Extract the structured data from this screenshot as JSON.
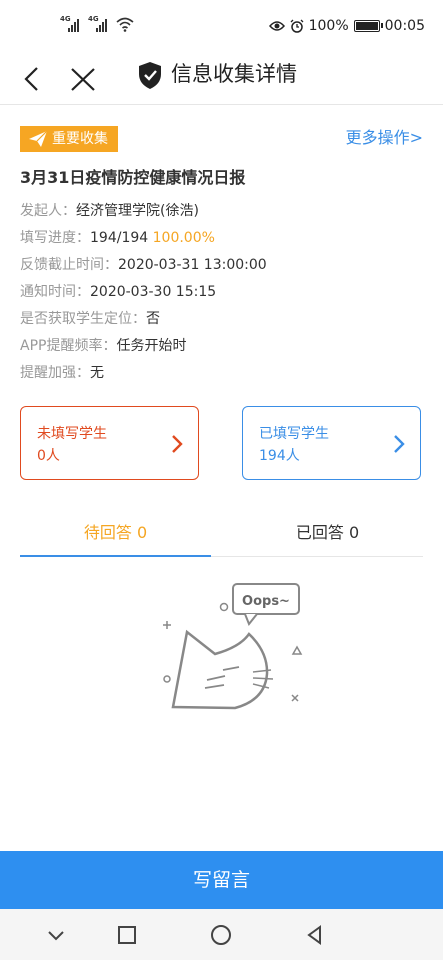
{
  "status_bar": {
    "signal1_tag": "4G",
    "signal2_tag": "4G",
    "battery": "100%",
    "time": "00:05"
  },
  "header": {
    "title": "信息收集详情"
  },
  "notice": {
    "tag": "重要收集",
    "more_actions": "更多操作>",
    "title": "3月31日疫情防控健康情况日报",
    "fields": [
      {
        "label": "发起人：",
        "value": "经济管理学院(徐浩)"
      },
      {
        "label": "填写进度：",
        "value": "194/194",
        "extra": "100.00%"
      },
      {
        "label": "反馈截止时间：",
        "value": "2020-03-31 13:00:00"
      },
      {
        "label": "通知时间：",
        "value": "2020-03-30 15:15"
      },
      {
        "label": "是否获取学生定位：",
        "value": "否"
      },
      {
        "label": "APP提醒频率：",
        "value": "任务开始时"
      },
      {
        "label": "提醒加强：",
        "value": "无"
      }
    ]
  },
  "cards": {
    "unfilled": {
      "title": "未填写学生",
      "count": "0人"
    },
    "filled": {
      "title": "已填写学生",
      "count": "194人"
    }
  },
  "tabs": [
    {
      "label": "待回答 0",
      "active": true
    },
    {
      "label": "已回答 0",
      "active": false
    }
  ],
  "empty_state": {
    "bubble": "Oops~"
  },
  "bottom_button": {
    "label": "写留言"
  },
  "colors": {
    "accent_blue": "#3a8ee6",
    "warning_orange": "#f5a623",
    "danger_red": "#e04a1f",
    "button_blue": "#2e8ff0"
  }
}
